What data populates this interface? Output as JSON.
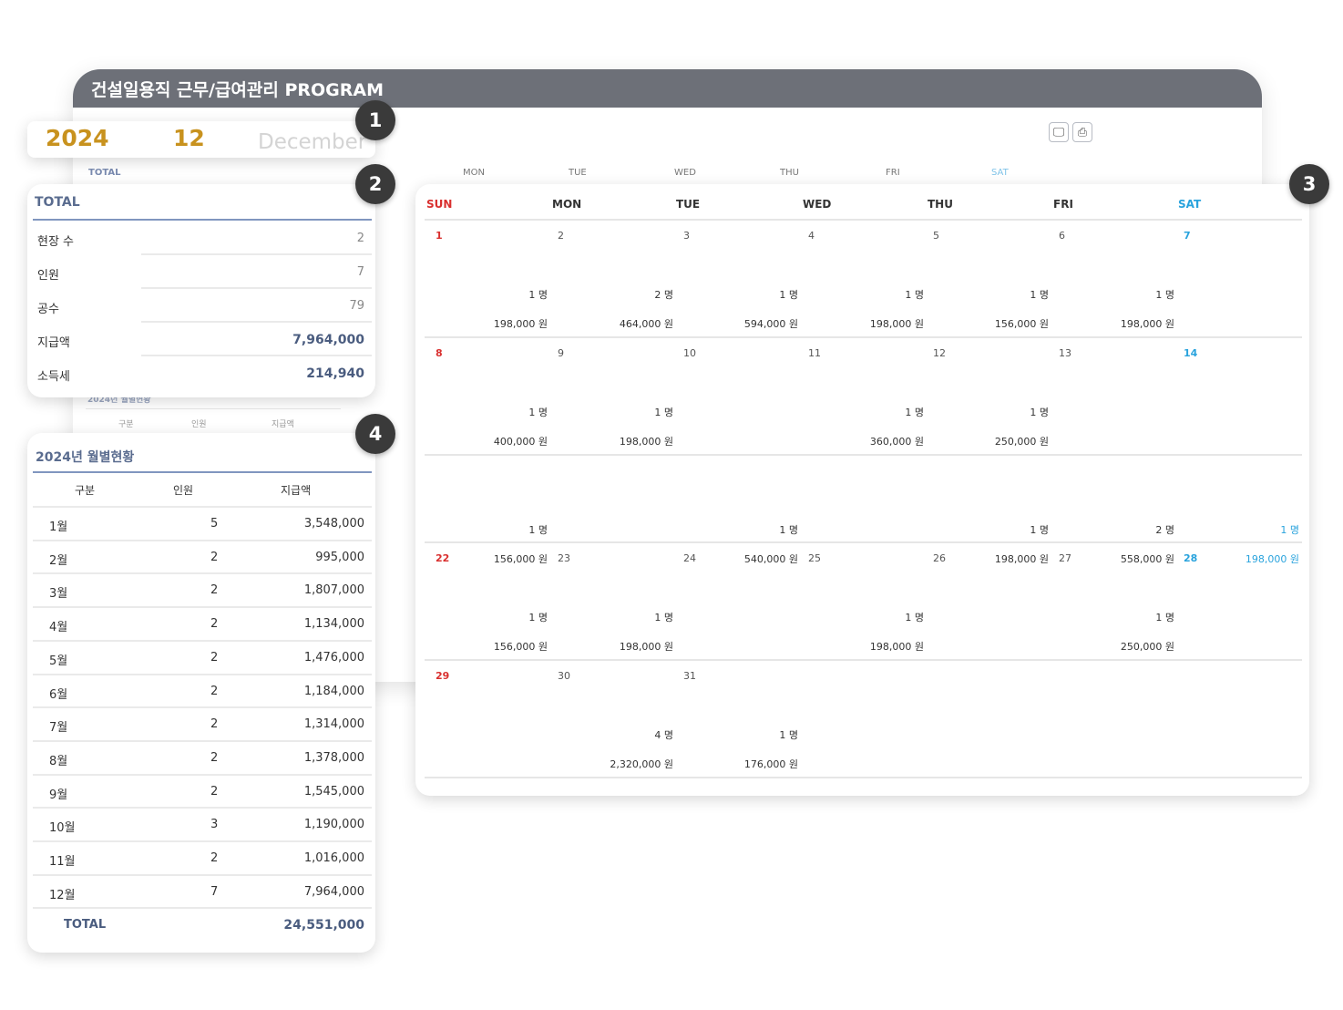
{
  "window": {
    "title": "건설일용직 근무/급여관리 PROGRAM",
    "icon_monitor": "🖵",
    "icon_print": "⎙"
  },
  "background": {
    "total_label": "TOTAL",
    "weekdays": [
      "MON",
      "TUE",
      "WED",
      "THU",
      "FRI",
      "SAT"
    ],
    "sub_title": "2024년 월별현황",
    "sub_cols": [
      "구분",
      "인원",
      "지급액"
    ]
  },
  "badges": [
    "1",
    "2",
    "3",
    "4"
  ],
  "period": {
    "year": "2024",
    "month": "12",
    "month_name": "December"
  },
  "total": {
    "title": "TOTAL",
    "rows": [
      {
        "label": "현장 수",
        "value": "2",
        "strong": false
      },
      {
        "label": "인원",
        "value": "7",
        "strong": false
      },
      {
        "label": "공수",
        "value": "79",
        "strong": false
      },
      {
        "label": "지급액",
        "value": "7,964,000",
        "strong": true
      },
      {
        "label": "소득세",
        "value": "214,940",
        "strong": true
      }
    ]
  },
  "monthly": {
    "title": "2024년 월별현황",
    "columns": [
      "구분",
      "인원",
      "지급액"
    ],
    "rows": [
      {
        "month": "1월",
        "people": "5",
        "amount": "3,548,000"
      },
      {
        "month": "2월",
        "people": "2",
        "amount": "995,000"
      },
      {
        "month": "3월",
        "people": "2",
        "amount": "1,807,000"
      },
      {
        "month": "4월",
        "people": "2",
        "amount": "1,134,000"
      },
      {
        "month": "5월",
        "people": "2",
        "amount": "1,476,000"
      },
      {
        "month": "6월",
        "people": "2",
        "amount": "1,184,000"
      },
      {
        "month": "7월",
        "people": "2",
        "amount": "1,314,000"
      },
      {
        "month": "8월",
        "people": "2",
        "amount": "1,378,000"
      },
      {
        "month": "9월",
        "people": "2",
        "amount": "1,545,000"
      },
      {
        "month": "10월",
        "people": "3",
        "amount": "1,190,000"
      },
      {
        "month": "11월",
        "people": "2",
        "amount": "1,016,000"
      },
      {
        "month": "12월",
        "people": "7",
        "amount": "7,964,000"
      }
    ],
    "total_label": "TOTAL",
    "total_amount": "24,551,000"
  },
  "calendar": {
    "weekdays": [
      "SUN",
      "MON",
      "TUE",
      "WED",
      "THU",
      "FRI",
      "SAT"
    ],
    "weeks": [
      [
        {
          "d": "1"
        },
        {
          "d": "2",
          "c": "1 명",
          "p": "198,000 원"
        },
        {
          "d": "3",
          "c": "2 명",
          "p": "464,000 원"
        },
        {
          "d": "4",
          "c": "1 명",
          "p": "594,000 원"
        },
        {
          "d": "5",
          "c": "1 명",
          "p": "198,000 원"
        },
        {
          "d": "6",
          "c": "1 명",
          "p": "156,000 원"
        },
        {
          "d": "7",
          "c": "1 명",
          "p": "198,000 원"
        }
      ],
      [
        {
          "d": "8"
        },
        {
          "d": "9",
          "c": "1 명",
          "p": "400,000 원"
        },
        {
          "d": "10",
          "c": "1 명",
          "p": "198,000 원"
        },
        {
          "d": "11"
        },
        {
          "d": "12",
          "c": "1 명",
          "p": "360,000 원"
        },
        {
          "d": "13",
          "c": "1 명",
          "p": "250,000 원"
        },
        {
          "d": "14"
        }
      ],
      [
        {
          "d": ""
        },
        {
          "d": "",
          "c": "1 명",
          "p": "156,000 원"
        },
        {
          "d": ""
        },
        {
          "d": "",
          "c": "1 명",
          "p": "540,000 원"
        },
        {
          "d": ""
        },
        {
          "d": "",
          "c": "1 명",
          "p": "198,000 원"
        },
        {
          "d": "",
          "c": "2 명",
          "p": "558,000 원"
        },
        {
          "d": "",
          "c": "1 명",
          "p": "198,000 원",
          "sat": true
        }
      ],
      [
        {
          "d": "22"
        },
        {
          "d": "23",
          "c": "1 명",
          "p": "156,000 원"
        },
        {
          "d": "24",
          "c": "1 명",
          "p": "198,000 원"
        },
        {
          "d": "25"
        },
        {
          "d": "26",
          "c": "1 명",
          "p": "198,000 원"
        },
        {
          "d": "27"
        },
        {
          "d": "28",
          "c": "1 명",
          "p": "250,000 원"
        }
      ],
      [
        {
          "d": "29"
        },
        {
          "d": "30"
        },
        {
          "d": "31",
          "c": "4 명",
          "p": "2,320,000 원"
        },
        {
          "d": "",
          "c": "1 명",
          "p": "176,000 원"
        },
        {
          "d": ""
        },
        {
          "d": ""
        },
        {
          "d": ""
        }
      ]
    ]
  }
}
